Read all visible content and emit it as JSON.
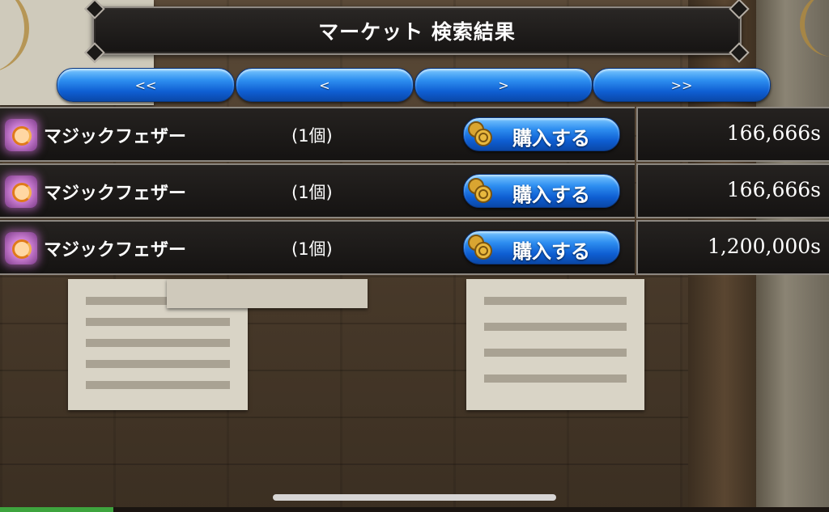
{
  "title": "マーケット 検索結果",
  "nav": [
    {
      "label": "<<"
    },
    {
      "label": "<"
    },
    {
      "label": ">"
    },
    {
      "label": ">>"
    }
  ],
  "items": [
    {
      "icon": "magic-feather-icon",
      "name": "マジックフェザー",
      "qty": "(1個)",
      "buy_label": "購入する",
      "price": "166,666s"
    },
    {
      "icon": "magic-feather-icon",
      "name": "マジックフェザー",
      "qty": "(1個)",
      "buy_label": "購入する",
      "price": "166,666s"
    },
    {
      "icon": "magic-feather-icon",
      "name": "マジックフェザー",
      "qty": "(1個)",
      "buy_label": "購入する",
      "price": "1,200,000s"
    }
  ],
  "colors": {
    "button_blue": "#1e6fe0",
    "panel_dark": "#1c1a18",
    "frame_silver": "#8c8780"
  }
}
